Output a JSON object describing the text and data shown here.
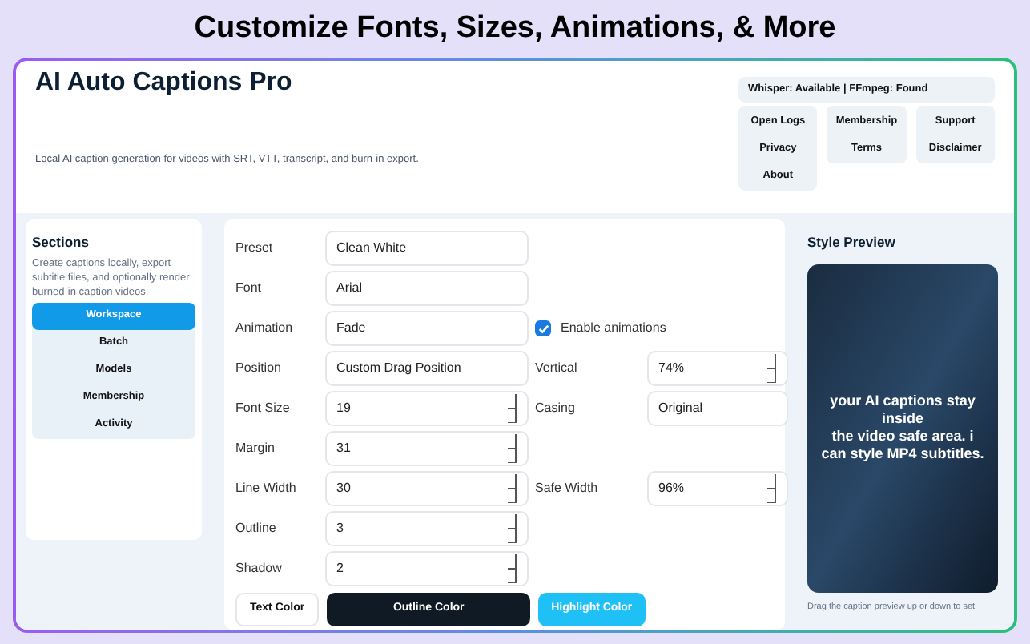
{
  "banner": {
    "title": "Customize Fonts, Sizes, Animations, & More"
  },
  "app": {
    "title": "AI Auto Captions Pro",
    "subtitle": "Local AI caption generation for videos with SRT, VTT, transcript, and burn-in export.",
    "status": "Whisper: Available | FFmpeg: Found",
    "link_groups": [
      [
        "Open Logs",
        "Privacy",
        "About"
      ],
      [
        "Membership",
        "Terms"
      ],
      [
        "Support",
        "Disclaimer"
      ]
    ]
  },
  "sidebar": {
    "title": "Sections",
    "description": "Create captions locally, export subtitle files, and optionally render burned-in caption videos.",
    "items": [
      {
        "label": "Workspace",
        "selected": true
      },
      {
        "label": "Batch",
        "selected": false
      },
      {
        "label": "Models",
        "selected": false
      },
      {
        "label": "Membership",
        "selected": false
      },
      {
        "label": "Activity",
        "selected": false
      }
    ]
  },
  "form": {
    "rows": [
      {
        "label": "Preset",
        "kind": "text",
        "value": "Clean White"
      },
      {
        "label": "Font",
        "kind": "text",
        "value": "Arial"
      },
      {
        "label": "Animation",
        "kind": "text",
        "value": "Fade",
        "right": {
          "kind": "checkbox",
          "label": "Enable animations",
          "checked": true
        }
      },
      {
        "label": "Position",
        "kind": "text",
        "value": "Custom Drag Position",
        "right": {
          "kind": "spin",
          "label": "Vertical",
          "value": "74%"
        }
      },
      {
        "label": "Font Size",
        "kind": "spin",
        "value": "19",
        "right": {
          "kind": "text",
          "label": "Casing",
          "value": "Original"
        }
      },
      {
        "label": "Margin",
        "kind": "spin",
        "value": "31"
      },
      {
        "label": "Line Width",
        "kind": "spin",
        "value": "30",
        "right": {
          "kind": "spin",
          "label": "Safe Width",
          "value": "96%"
        }
      },
      {
        "label": "Outline",
        "kind": "spin",
        "value": "3"
      },
      {
        "label": "Shadow",
        "kind": "spin",
        "value": "2"
      }
    ],
    "color_buttons": [
      {
        "label": "Text Color",
        "color": "#ffffff"
      },
      {
        "label": "Outline Color",
        "color": "#0f1a24"
      },
      {
        "label": "Highlight Color",
        "color": "#1ec0f5"
      }
    ]
  },
  "preview": {
    "title": "Style Preview",
    "caption_lines": [
      "your AI captions stay inside",
      "the video safe area. i can style MP4 subtitles."
    ],
    "hint": "Drag the caption preview up or down to set"
  }
}
